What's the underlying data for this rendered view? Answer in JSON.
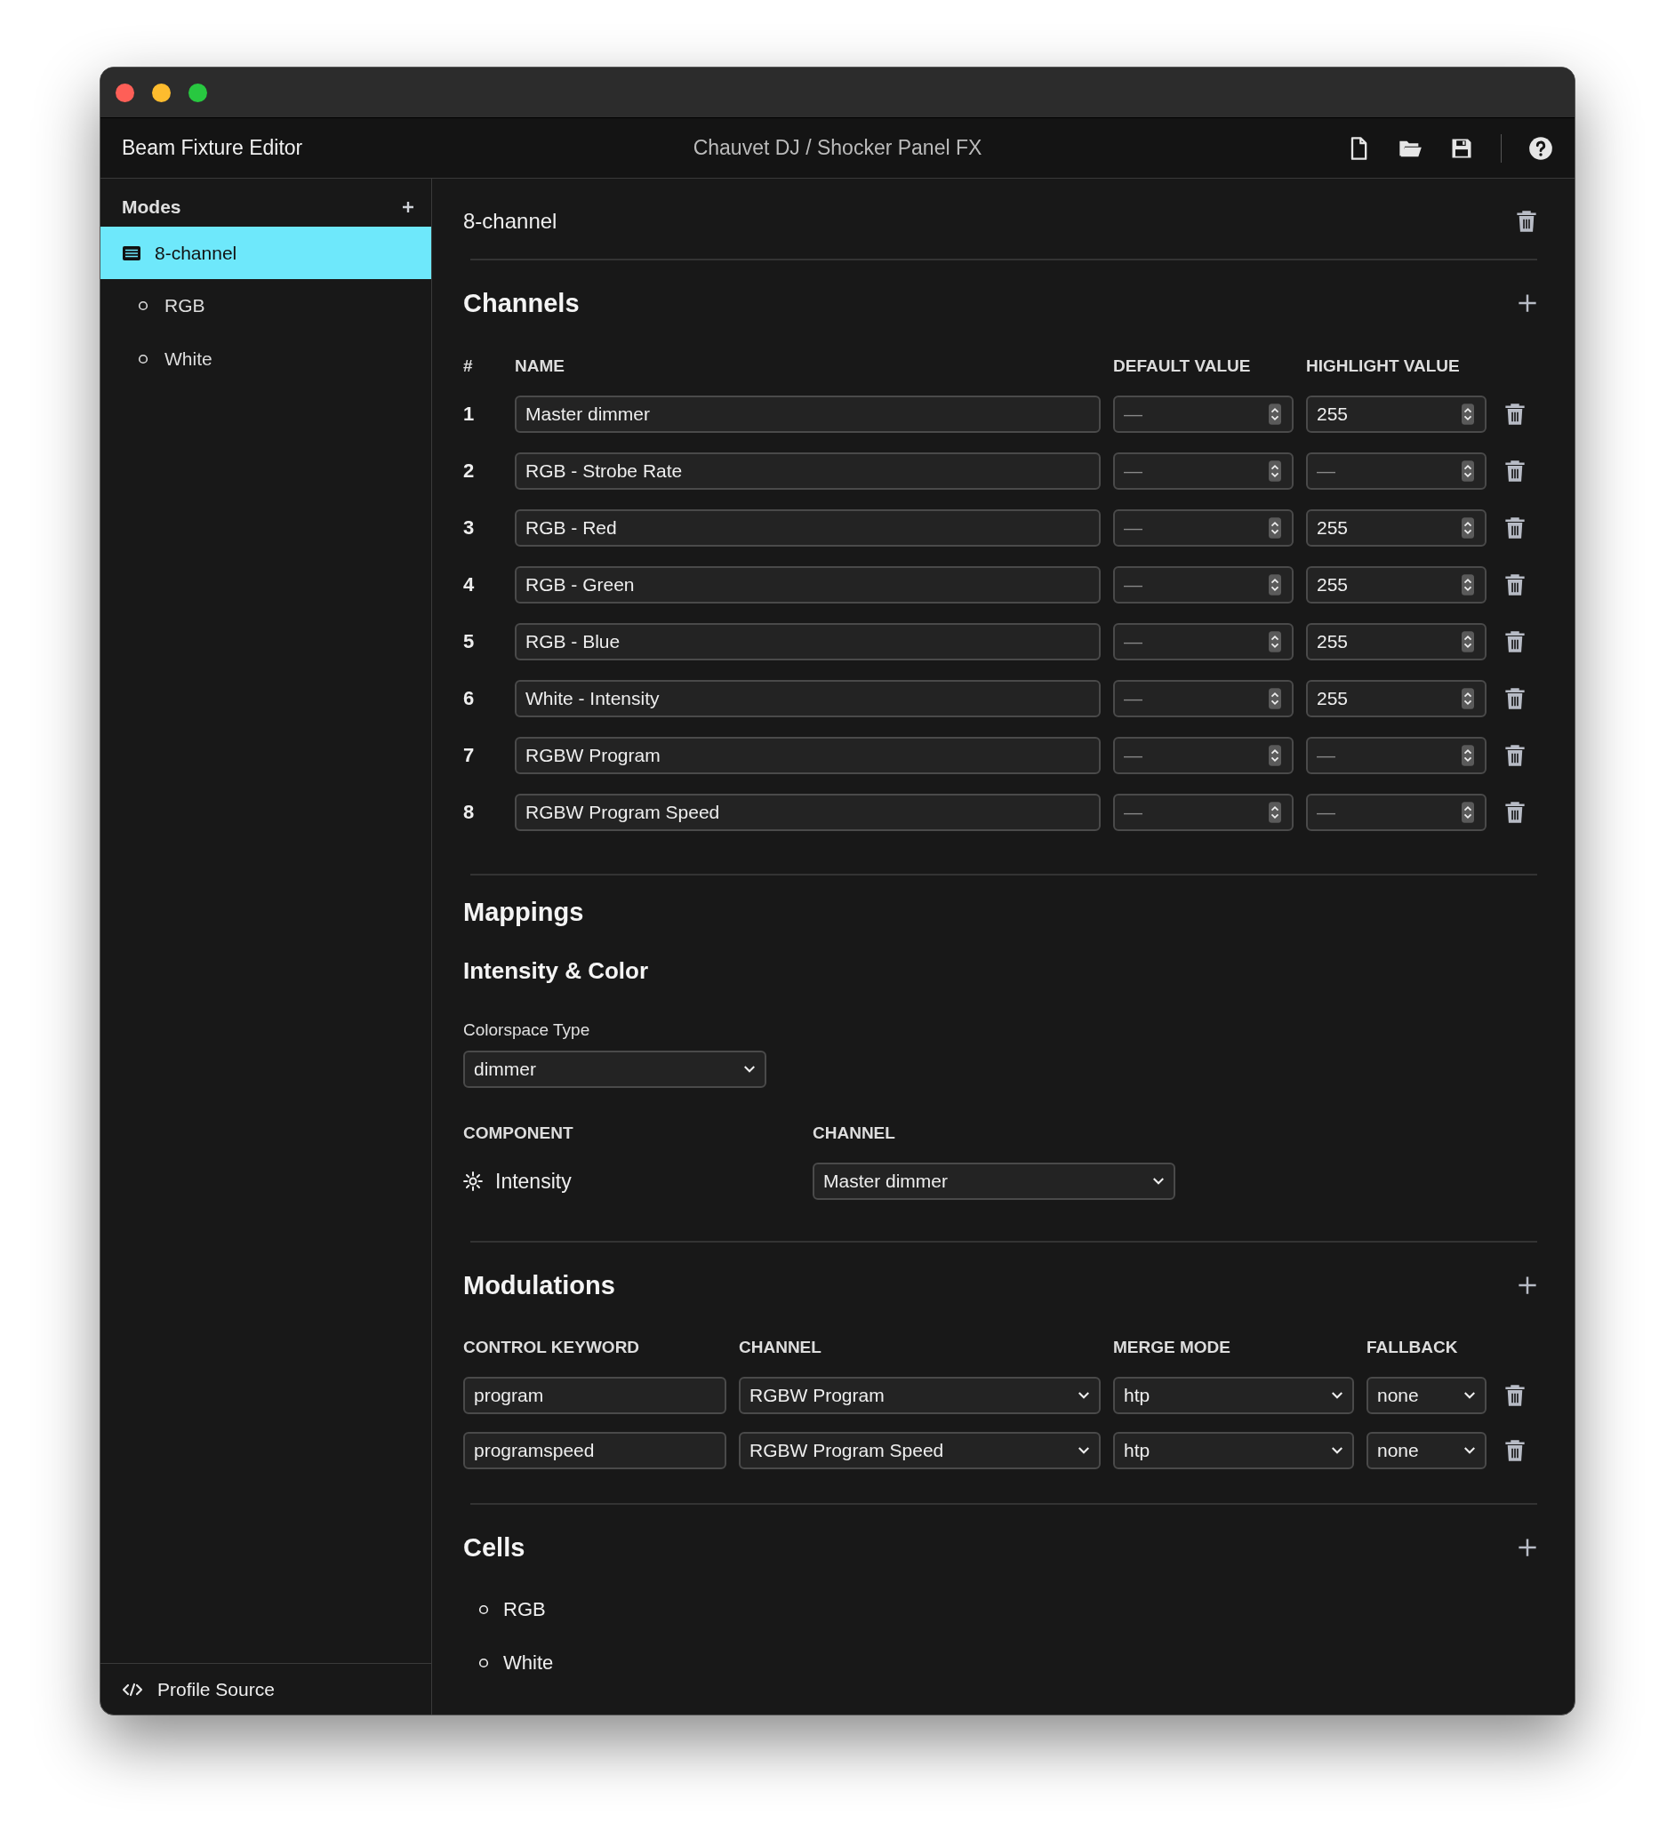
{
  "window": {
    "title": "Beam Fixture Editor",
    "subtitle": "Chauvet DJ / Shocker Panel FX"
  },
  "sidebar": {
    "heading": "Modes",
    "modes": [
      {
        "label": "8-channel",
        "selected": true,
        "children": [
          {
            "label": "RGB",
            "selected": false
          },
          {
            "label": "White",
            "selected": false
          }
        ]
      }
    ],
    "footer": "Profile Source"
  },
  "mode": {
    "title": "8-channel"
  },
  "channels": {
    "heading": "Channels",
    "columns": [
      "#",
      "NAME",
      "DEFAULT VALUE",
      "HIGHLIGHT VALUE"
    ],
    "rows": [
      {
        "number": "1",
        "name": "Master dimmer",
        "default_value": {
          "placeholder": "—"
        },
        "highlight_value": {
          "value": "255"
        }
      },
      {
        "number": "2",
        "name": "RGB - Strobe Rate",
        "default_value": {
          "placeholder": "—"
        },
        "highlight_value": {
          "placeholder": "—"
        }
      },
      {
        "number": "3",
        "name": "RGB - Red",
        "default_value": {
          "placeholder": "—"
        },
        "highlight_value": {
          "value": "255"
        }
      },
      {
        "number": "4",
        "name": "RGB - Green",
        "default_value": {
          "placeholder": "—"
        },
        "highlight_value": {
          "value": "255"
        }
      },
      {
        "number": "5",
        "name": "RGB - Blue",
        "default_value": {
          "placeholder": "—"
        },
        "highlight_value": {
          "value": "255"
        }
      },
      {
        "number": "6",
        "name": "White - Intensity",
        "default_value": {
          "placeholder": "—"
        },
        "highlight_value": {
          "value": "255"
        }
      },
      {
        "number": "7",
        "name": "RGBW Program",
        "default_value": {
          "placeholder": "—"
        },
        "highlight_value": {
          "placeholder": "—"
        }
      },
      {
        "number": "8",
        "name": "RGBW Program Speed",
        "default_value": {
          "placeholder": "—"
        },
        "highlight_value": {
          "placeholder": "—"
        }
      }
    ]
  },
  "mappings": {
    "heading": "Mappings",
    "subheading": "Intensity & Color",
    "colorspace": {
      "label": "Colorspace Type",
      "value": "dimmer"
    },
    "columns": [
      "COMPONENT",
      "CHANNEL"
    ],
    "rows": [
      {
        "component": "Intensity",
        "channel": "Master dimmer"
      }
    ]
  },
  "modulations": {
    "heading": "Modulations",
    "columns": [
      "CONTROL KEYWORD",
      "CHANNEL",
      "MERGE MODE",
      "FALLBACK"
    ],
    "rows": [
      {
        "keyword": "program",
        "channel": "RGBW Program",
        "merge_mode": "htp",
        "fallback": "none"
      },
      {
        "keyword": "programspeed",
        "channel": "RGBW Program Speed",
        "merge_mode": "htp",
        "fallback": "none"
      }
    ]
  },
  "cells": {
    "heading": "Cells",
    "items": [
      "RGB",
      "White"
    ]
  }
}
